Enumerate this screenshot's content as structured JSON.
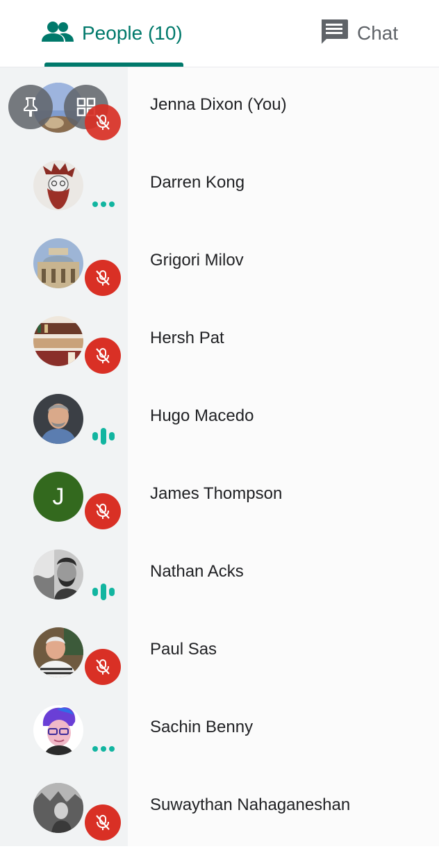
{
  "tabs": {
    "people": {
      "label": "People (10)",
      "icon": "people-icon",
      "selected": true
    },
    "chat": {
      "label": "Chat",
      "icon": "chat-icon",
      "selected": false
    }
  },
  "colors": {
    "accent": "#00796b",
    "mute_red": "#d93025",
    "speaking_teal": "#12b5a0",
    "side_column": "#f1f3f4"
  },
  "participants": [
    {
      "name": "Jenna Dixon (You)",
      "status": "muted",
      "self": true,
      "actions": [
        "pin-icon",
        "grid-icon"
      ]
    },
    {
      "name": "Darren Kong",
      "status": "idle"
    },
    {
      "name": "Grigori Milov",
      "status": "muted"
    },
    {
      "name": "Hersh Pat",
      "status": "muted"
    },
    {
      "name": "Hugo Macedo",
      "status": "speaking"
    },
    {
      "name": "James Thompson",
      "status": "muted",
      "initial": "J"
    },
    {
      "name": "Nathan Acks",
      "status": "speaking"
    },
    {
      "name": "Paul Sas",
      "status": "muted"
    },
    {
      "name": "Sachin Benny",
      "status": "idle"
    },
    {
      "name": "Suwaythan Nahaganeshan",
      "status": "muted"
    }
  ]
}
